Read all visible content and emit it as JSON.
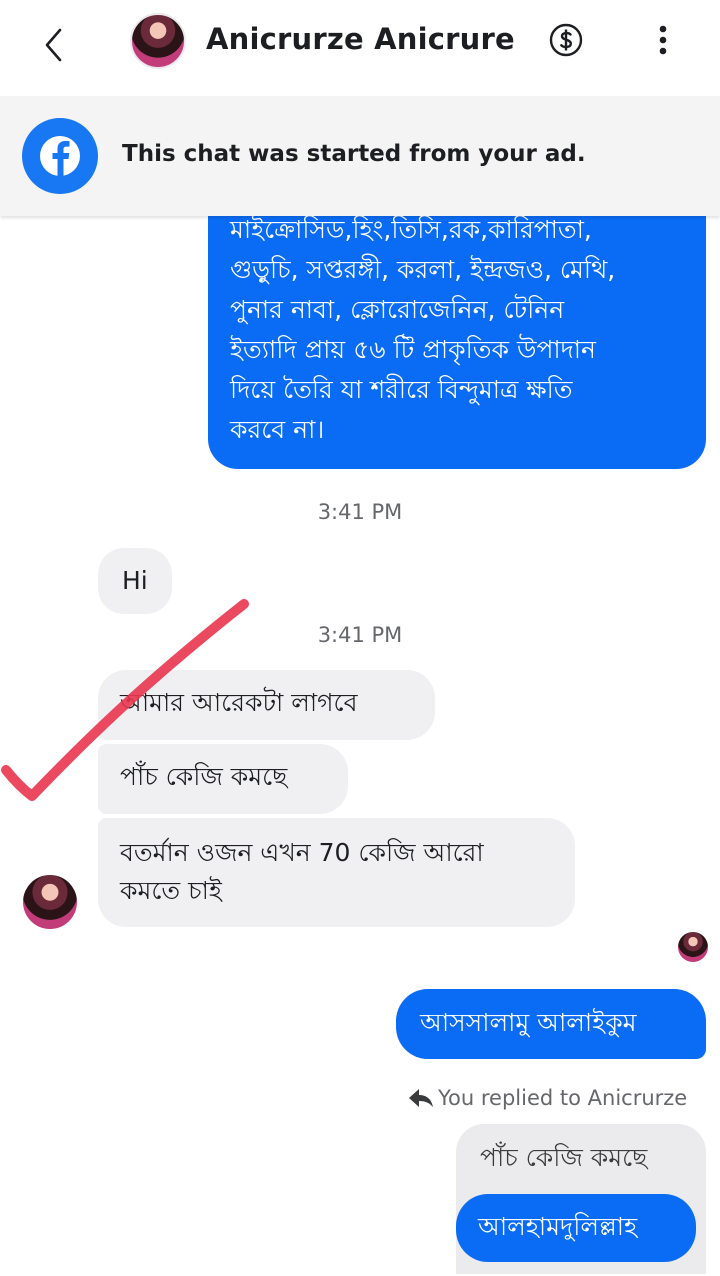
{
  "header": {
    "title": "Anicrurze Anicrure",
    "back_icon": "chevron-left-icon",
    "dollar_icon": "dollar-circle-icon",
    "more_icon": "more-vertical-icon"
  },
  "ad_banner": {
    "text": "This chat was started from your ad.",
    "icon": "facebook-icon"
  },
  "messages": {
    "long_outgoing": [
      "মাইক্রোসিড,হিং,তিসি,রক,কারিপাতা,",
      "গুড়ুচি, সপ্তরঙ্গী, করলা, ইন্দ্রজও, মেথি,",
      "পুনার নাবা, ক্লোরোজেনিন, টেনিন",
      "ইত্যাদি প্রায় ৫৬ টি প্রাকৃতিক উপাদান",
      "দিয়ে তৈরি  যা শরীরে বিন্দুমাত্র ক্ষতি",
      "করবে না।"
    ],
    "time_1": "3:41 PM",
    "hi": "Hi",
    "time_2": "3:41 PM",
    "in_1": "আমার  আরেকটা লাগবে",
    "in_2": "পাঁচ কেজি কমছে",
    "in_3_line1": "বতর্মান  ওজন এখন 70 কেজি আরো",
    "in_3_line2": "কমতে চাই",
    "out_salam": "আসসালামু আলাইকুম",
    "reply_label": "You replied to Anicrurze",
    "quoted": "পাঁচ কেজি কমছে",
    "out_alhamdulillah": "আলহামদুলিল্লাহ"
  },
  "colors": {
    "outgoing_bubble": "#0a6cf5",
    "incoming_bubble": "#f0f0f2",
    "facebook_blue": "#1877f2",
    "check_mark": "#e8354f"
  }
}
